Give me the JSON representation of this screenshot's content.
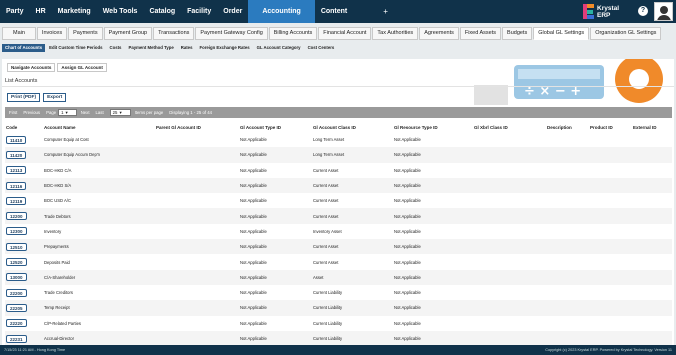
{
  "topnav": {
    "items": [
      "Party",
      "HR",
      "Marketing",
      "Web Tools",
      "Catalog",
      "Facility",
      "Order",
      "Accounting",
      "Content"
    ],
    "active": "Accounting",
    "plus": "+",
    "brand_line1": "Krystal",
    "brand_line2": "ERP",
    "help": "?"
  },
  "tabs": [
    "Main",
    "Invoices",
    "Payments",
    "Payment Group",
    "Transactions",
    "Payment Gateway Config",
    "Billing Accounts",
    "Financial Account",
    "Tax Authorities",
    "Agreements",
    "Fixed Assets",
    "Budgets",
    "Global GL Settings",
    "Organization GL Settings"
  ],
  "active_tab": "Global GL Settings",
  "subtabs": [
    "Chart of Accounts",
    "Edit Custom Time Periods",
    "Costs",
    "Payment Method Type",
    "Rates",
    "Foreign Exchange Rates",
    "GL Account Category",
    "Cost Centers"
  ],
  "active_subtab": "Chart of Accounts",
  "actions": [
    "Navigate Accounts",
    "Assign GL Account"
  ],
  "list_title": "List Accounts",
  "buttons": {
    "print": "Print (PDF)",
    "export": "Export"
  },
  "pager": {
    "first": "First",
    "previous": "Previous",
    "page_label": "Page",
    "page_value": "1",
    "next": "Next",
    "last": "Last",
    "per_page_value": "25",
    "per_page_label": "Items per page",
    "displaying": "Displaying 1 - 25 of 44"
  },
  "columns": [
    "Code",
    "Account Name",
    "Parent Gl Account ID",
    "Gl Account Type ID",
    "Gl Account Class ID",
    "Gl Resource Type ID",
    "Gl Xbrl Class ID",
    "Description",
    "Product ID",
    "External ID"
  ],
  "rows": [
    {
      "code": "11410",
      "name": "Computer Equip at Cost",
      "type": "Not Applicable",
      "class": "Long Term Asset",
      "resource": "Not Applicable"
    },
    {
      "code": "11420",
      "name": "Computer Equip Accum Dep'n",
      "type": "Not Applicable",
      "class": "Long Term Asset",
      "resource": "Not Applicable"
    },
    {
      "code": "12113",
      "name": "BOC-HKD C/A",
      "type": "Not Applicable",
      "class": "Current Asset",
      "resource": "Not Applicable"
    },
    {
      "code": "12116",
      "name": "BOC-HKD S/A",
      "type": "Not Applicable",
      "class": "Current Asset",
      "resource": "Not Applicable"
    },
    {
      "code": "12119",
      "name": "BOC USD A/C",
      "type": "Not Applicable",
      "class": "Current Asset",
      "resource": "Not Applicable"
    },
    {
      "code": "12200",
      "name": "Trade Debtors",
      "type": "Not Applicable",
      "class": "Current Asset",
      "resource": "Not Applicable"
    },
    {
      "code": "12300",
      "name": "Inventory",
      "type": "Not Applicable",
      "class": "Inventory Asset",
      "resource": "Not Applicable"
    },
    {
      "code": "12510",
      "name": "Prepayments",
      "type": "Not Applicable",
      "class": "Current Asset",
      "resource": "Not Applicable"
    },
    {
      "code": "12520",
      "name": "Deposits Paid",
      "type": "Not Applicable",
      "class": "Current Asset",
      "resource": "Not Applicable"
    },
    {
      "code": "13000",
      "name": "C/A-Shareholder",
      "type": "Not Applicable",
      "class": "Asset",
      "resource": "Not Applicable"
    },
    {
      "code": "22200",
      "name": "Trade Creditors",
      "type": "Not Applicable",
      "class": "Current Liability",
      "resource": "Not Applicable"
    },
    {
      "code": "22205",
      "name": "Temp Receipt",
      "type": "Not Applicable",
      "class": "Current Liability",
      "resource": "Not Applicable"
    },
    {
      "code": "22220",
      "name": "C/P-Related Parties",
      "type": "Not Applicable",
      "class": "Current Liability",
      "resource": "Not Applicable"
    },
    {
      "code": "22231",
      "name": "Accrual-Director",
      "type": "Not Applicable",
      "class": "Current Liability",
      "resource": "Not Applicable"
    }
  ],
  "footer": {
    "left": "7/15/23 11:21 AM - Hong Kong Time",
    "right": "Copyright (c) 2023 Krystal ERP. Powered by Krystal Technology. Version 11"
  }
}
